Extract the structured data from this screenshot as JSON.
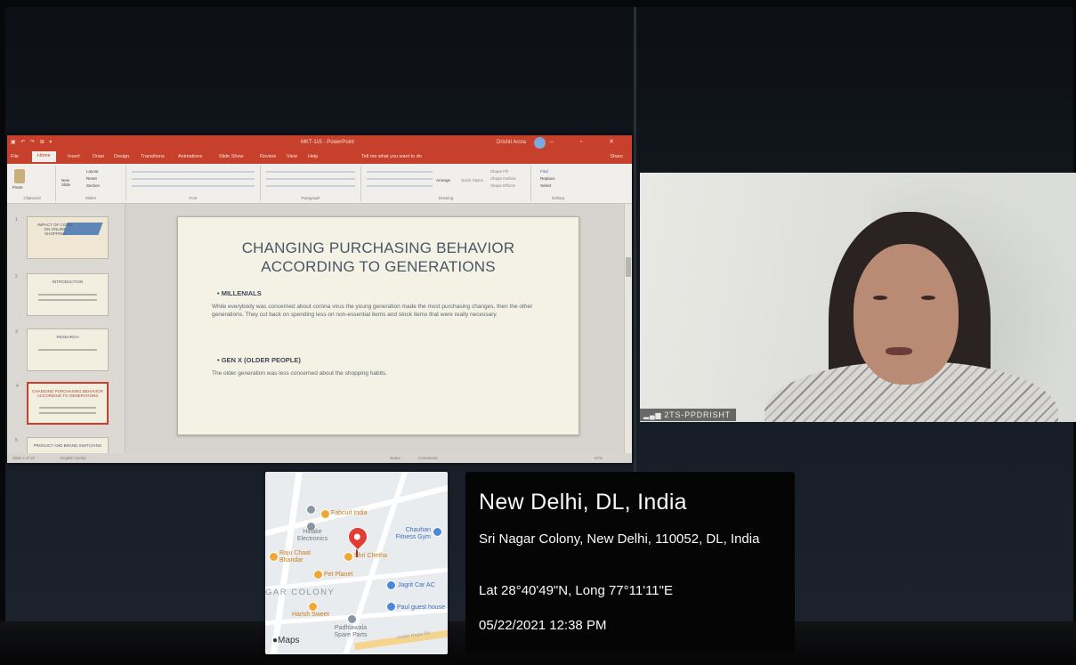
{
  "powerpoint": {
    "title": "MKT-115 - PowerPoint",
    "user_name": "Drishti Arora",
    "user_initials": "DA",
    "window_buttons": "– ▫ ✕",
    "quick_access": "▣ ↶ ↷ ⊞ ▾",
    "tabs": [
      "File",
      "Home",
      "Insert",
      "Draw",
      "Design",
      "Transitions",
      "Animations",
      "Slide Show",
      "Review",
      "View",
      "Help"
    ],
    "tell_me": "Tell me what you want to do",
    "share": "Share",
    "ribbon_groups": [
      "Clipboard",
      "Slides",
      "Font",
      "Paragraph",
      "Drawing",
      "Editing"
    ],
    "ribbon_buttons": {
      "paste": "Paste",
      "new_slide": "New Slide",
      "layout": "Layout",
      "reset": "Reset",
      "section": "Section",
      "arrange": "Arrange",
      "quick_styles": "Quick Styles",
      "shape_fill": "Shape Fill",
      "shape_outline": "Shape Outline",
      "shape_effects": "Shape Effects",
      "find": "Find",
      "replace": "Replace",
      "select": "Select"
    },
    "thumbnails": [
      {
        "num": "1",
        "text": "IMPACT OF COVID ON ONLINE SHOPPING"
      },
      {
        "num": "2",
        "text": "INTRODUCTION"
      },
      {
        "num": "3",
        "text": "RESEARCH"
      },
      {
        "num": "4",
        "text": "CHANGING PURCHASING BEHAVIOR ACCORDING TO GENERATIONS"
      },
      {
        "num": "5",
        "text": "PRODUCT AND BRAND SWITCHING"
      }
    ],
    "slide": {
      "title_line1": "CHANGING PURCHASING BEHAVIOR",
      "title_line2": "ACCORDING TO GENERATIONS",
      "heading1": "• MILLENIALS",
      "para1": "While everybody was concerned about corona virus the young generation made the most purchasing changes, then the other generations. They cut back on spending less on non-essential items and stock items that were really necessary.",
      "heading2": "• GEN X (OLDER PEOPLE)",
      "para2": "The older generation was less concerned about the shopping habits."
    },
    "status": {
      "slide_of": "Slide 4 of 10",
      "language": "English (India)",
      "notes": "Notes",
      "comments": "Comments",
      "zoom": "67%"
    }
  },
  "video": {
    "participant_name": "2TS-PPDRISHT",
    "signal_icon": "signal-bars-icon"
  },
  "map": {
    "pois": [
      {
        "name": "Fabcurl India",
        "color": "orange"
      },
      {
        "name": "Hiltake Electronics",
        "color": "gray"
      },
      {
        "name": "Chauhan Fitness Gym",
        "color": "blue"
      },
      {
        "name": "Raju Chaat Bhandar",
        "color": "orange"
      },
      {
        "name": "Shri Chetha",
        "color": "orange"
      },
      {
        "name": "Pet Planet",
        "color": "orange"
      },
      {
        "name": "Jagrit Car AC",
        "color": "blue"
      },
      {
        "name": "Harish Sweet",
        "color": "orange"
      },
      {
        "name": "Paul guest house",
        "color": "blue"
      },
      {
        "name": "Padhiawala Spare Parts",
        "color": "gray"
      }
    ],
    "area_label": "GAR COLONY",
    "street_label": "Gulabi Nagar Rd",
    "maps_brand": "Maps",
    "colors": {
      "pin": "#e23c33",
      "poi": "#f0a734",
      "blue_poi": "#4d87d9"
    }
  },
  "location": {
    "city": "New Delhi, DL, India",
    "address": "Sri Nagar Colony, New Delhi, 110052, DL, India",
    "coordinates": "Lat 28°40'49\"N, Long 77°11'11\"E",
    "datetime": "05/22/2021 12:38 PM"
  }
}
